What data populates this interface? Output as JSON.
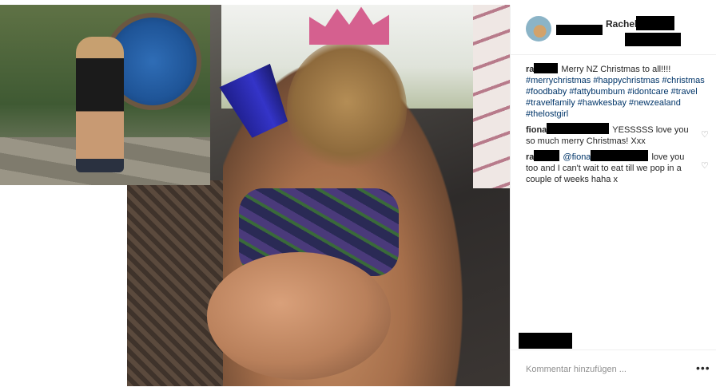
{
  "post": {
    "username": "Rachel",
    "caption_user": "ra",
    "caption_text": "Merry NZ Christmas to all!!!!",
    "hashtags": "#merrychristmas #happychristmas #christmas #foodbaby #fattybumbum #idontcare #travel #travelfamily #hawkesbay #newzealand #thelostgirl"
  },
  "comments": [
    {
      "user": "fiona",
      "text": "YESSSSS love you so much merry Christmas! Xxx"
    },
    {
      "user": "ra",
      "mention": "@fiona",
      "text": "love you too and I can't wait to eat till we pop in a couple of weeks haha x"
    }
  ],
  "footer": {
    "add_comment_placeholder": "Kommentar hinzufügen ...",
    "more_label": "•••"
  },
  "icons": {
    "like": "heart-outline-icon",
    "more": "more-options-icon"
  },
  "colors": {
    "hashtag": "#003569",
    "redaction": "#000000"
  }
}
